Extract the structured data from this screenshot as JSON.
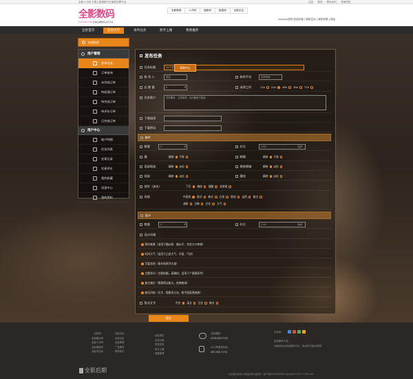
{
  "topbar": {
    "left": "全影人才网 中国儿童摄影专业摄影招聘平台",
    "right": [
      "注册",
      "登录",
      "联系我们",
      "快速导航"
    ]
  },
  "header": {
    "logo": "全影数码",
    "logo_url": "FL7DAD.COM",
    "logo_slogan": "影楼后期服务全影平台",
    "menu": [
      "全影微博",
      "人才网",
      "摄影网",
      "影楼网",
      "全影论坛"
    ],
    "welcome": "xiaoyou您好,欢迎光临 | 我的主页 | 我的消息 | 退出"
  },
  "nav": [
    "全影首页",
    "任务大厅",
    "发布任务",
    "新手上路",
    "我要推荐"
  ],
  "sidebar": {
    "search_label": "快速检索",
    "group1_title": "用户管理",
    "group1": [
      "发布任务",
      "订单查询",
      "未完成订单",
      "待处理订单",
      "待完成订单",
      "待评价订单",
      "已完成订单"
    ],
    "group2_title": "用户中心",
    "group2": [
      "账户明细",
      "任务列表",
      "交易记录",
      "交易评价",
      "我的收藏",
      "消息中心",
      "我的资料"
    ]
  },
  "form": {
    "title": "发布任务",
    "help": "帮助中心",
    "task_title_label": "任务标题",
    "task_title_ph": "25个字符以内",
    "contact_label": "联 系 人",
    "contact_ph": "姓名",
    "phone_label": "联系手机",
    "phone_ph": "手机号码",
    "qty_label": "总 数 量",
    "qty_val": "0",
    "qty_unit": "P",
    "deadline_label": "选择工时",
    "deadline_opts": [
      "12h",
      "24h",
      "48h",
      "36h",
      "72h"
    ],
    "desc_label": "任务简介",
    "desc_ph": "任务要求、注意事项，对问题进行描述",
    "download_label": "下载链接",
    "code_label": "下载密码",
    "retouch_title": "修片",
    "count_label": "数量",
    "count_val": "0",
    "count_unit": "P",
    "price_label": "价位",
    "price_val": "2.00",
    "price_unit": "元/P",
    "skin_label": "磨",
    "skin_opts": [
      "精修",
      "干修"
    ],
    "eye_label": "眼睛",
    "eye_opts": [
      "精修",
      "干修"
    ],
    "blemish_label": "面部瑕疵",
    "blemish_opts": [
      "精修",
      "淡化"
    ],
    "bgdefect_label": "服装褶皱",
    "bgdefect_opts": [
      "精修",
      "淡化"
    ],
    "neck_label": "颈部",
    "neck_opts": [
      "精修",
      "淡化"
    ],
    "teeth_label": "磨纹",
    "teeth_opts": [
      "精修",
      "淡化"
    ],
    "shape_label": "塑形（液化）",
    "shape_opts": [
      "下巴",
      "微修",
      "细腰",
      "非常规"
    ],
    "style_label": "风格",
    "style_opts": [
      "中国风",
      "欧式",
      "韩式",
      "日系",
      "原创",
      "自然",
      "复古",
      "清新",
      "日韩",
      "文艺",
      "大气"
    ],
    "design_title": "设计",
    "design_count_label": "数量",
    "design_count_val": "0",
    "design_count_unit": "P",
    "design_price_label": "价位",
    "design_price_val": "2.00",
    "design_price_unit": "元/P",
    "design_style_label": "设计风格",
    "design_styles": [
      "简约唯美（适用于婚纱照、婚纱写、符合大众审美）",
      "时尚大气（适用于凸显大气、华丽、气质）",
      "可爱花俏（青年和系列大量）",
      "主题系列（主题拍摄，高端的，适用于个案图系列）",
      "复古端庄（素雅简洁复古，经典格调）",
      "新旧风格（文字、图案多元化，赋予画面潮流感）"
    ],
    "lang_label": "版式文字",
    "lang_opts": [
      "中文",
      "英文",
      "日文",
      "韩文"
    ],
    "submit": "提交"
  },
  "footer": {
    "col1": [
      "全影网",
      "全影婚纱网",
      "全影人才网",
      "全影摄影网",
      "全影学社网"
    ],
    "col2": [
      "全影论坛",
      "全影社区",
      "全影微博",
      "广告服务",
      "联系我们"
    ],
    "col3": [
      "全影项目",
      "任务分类",
      "发布任务",
      "新手上路",
      "我要推荐"
    ],
    "hotline_label": "全影客服：",
    "hotline": "0536-8337192",
    "hotline2_label": "24小时服务热线：",
    "hotline2": "400-000-7192",
    "follow": "分享到：",
    "intro_title": "全影数码介绍：",
    "intro": "中国最新最全的后期服务平台，通过我们掌握最新图库",
    "copyright": "全影数码有限公司版权所有 备案号：鲁ICP备10009594号  copyright©2011 7192.com",
    "flogo": "全影后期"
  }
}
